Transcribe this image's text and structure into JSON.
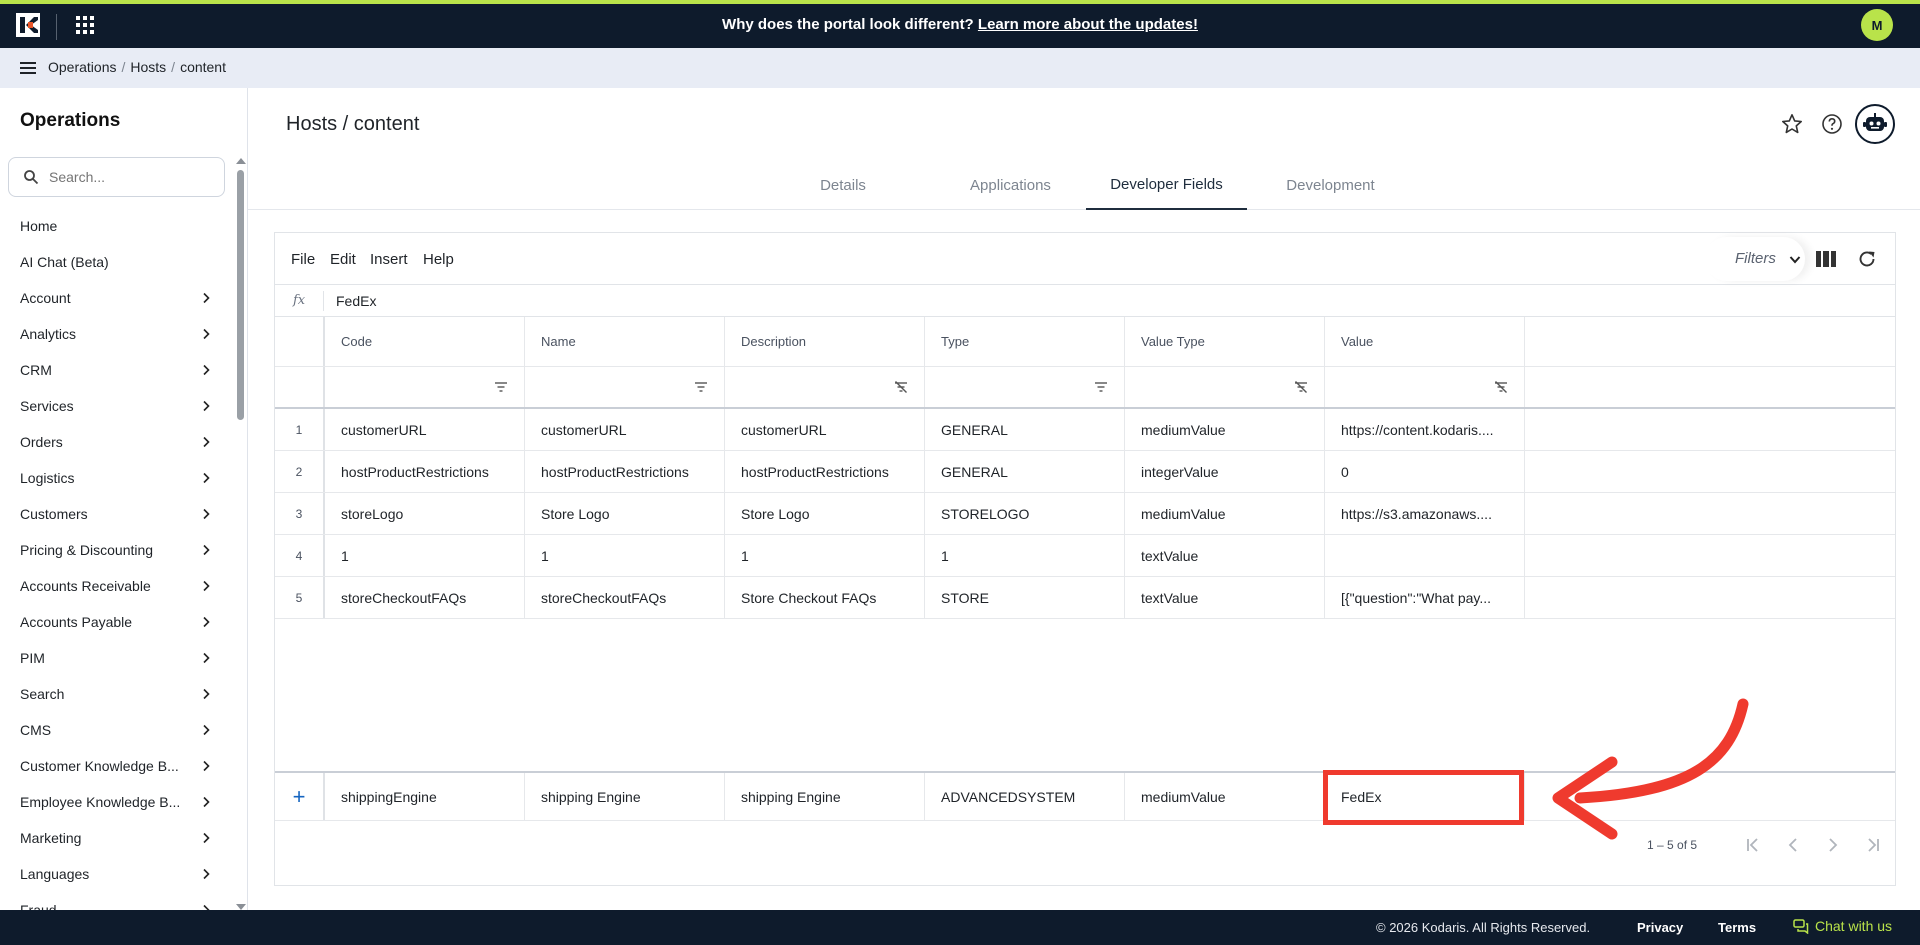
{
  "banner": {
    "question": "Why does the portal look different?",
    "link": "Learn more about the updates!",
    "avatar_initial": "M"
  },
  "breadcrumb": [
    "Operations",
    "Hosts",
    "content"
  ],
  "sidebar": {
    "title": "Operations",
    "search_placeholder": "Search...",
    "items": [
      {
        "label": "Home",
        "chevron": false
      },
      {
        "label": "AI Chat (Beta)",
        "chevron": false
      },
      {
        "label": "Account",
        "chevron": true
      },
      {
        "label": "Analytics",
        "chevron": true
      },
      {
        "label": "CRM",
        "chevron": true
      },
      {
        "label": "Services",
        "chevron": true
      },
      {
        "label": "Orders",
        "chevron": true
      },
      {
        "label": "Logistics",
        "chevron": true
      },
      {
        "label": "Customers",
        "chevron": true
      },
      {
        "label": "Pricing & Discounting",
        "chevron": true
      },
      {
        "label": "Accounts Receivable",
        "chevron": true
      },
      {
        "label": "Accounts Payable",
        "chevron": true
      },
      {
        "label": "PIM",
        "chevron": true
      },
      {
        "label": "Search",
        "chevron": true
      },
      {
        "label": "CMS",
        "chevron": true
      },
      {
        "label": "Customer Knowledge B...",
        "chevron": true
      },
      {
        "label": "Employee Knowledge B...",
        "chevron": true
      },
      {
        "label": "Marketing",
        "chevron": true
      },
      {
        "label": "Languages",
        "chevron": true
      },
      {
        "label": "Fraud",
        "chevron": true
      }
    ]
  },
  "page": {
    "title": "Hosts / content",
    "tabs": [
      "Details",
      "Applications",
      "Developer Fields",
      "Development"
    ],
    "active_tab": "Developer Fields"
  },
  "grid": {
    "menu": [
      "File",
      "Edit",
      "Insert",
      "Help"
    ],
    "filters_label": "Filters",
    "fx_label": "fx",
    "fx_value": "FedEx",
    "columns": [
      "Code",
      "Name",
      "Description",
      "Type",
      "Value Type",
      "Value"
    ],
    "rows": [
      {
        "n": "1",
        "cells": [
          "customerURL",
          "customerURL",
          "customerURL",
          "GENERAL",
          "mediumValue",
          "https://content.kodaris...."
        ]
      },
      {
        "n": "2",
        "cells": [
          "hostProductRestrictions",
          "hostProductRestrictions",
          "hostProductRestrictions",
          "GENERAL",
          "integerValue",
          "0"
        ]
      },
      {
        "n": "3",
        "cells": [
          "storeLogo",
          "Store Logo",
          "Store Logo",
          "STORELOGO",
          "mediumValue",
          "https://s3.amazonaws...."
        ]
      },
      {
        "n": "4",
        "cells": [
          "1",
          "1",
          "1",
          "1",
          "textValue",
          ""
        ]
      },
      {
        "n": "5",
        "cells": [
          "storeCheckoutFAQs",
          "storeCheckoutFAQs",
          "Store Checkout FAQs",
          "STORE",
          "textValue",
          "[{\"question\":\"What pay..."
        ]
      }
    ],
    "new_row": {
      "add": "+",
      "cells": [
        "shippingEngine",
        "shipping Engine",
        "shipping Engine",
        "ADVANCEDSYSTEM",
        "mediumValue",
        "FedEx"
      ]
    },
    "pagination": "1 – 5 of 5"
  },
  "footer": {
    "copyright": "© 2026 Kodaris. All Rights Reserved.",
    "privacy": "Privacy",
    "terms": "Terms",
    "chat": "Chat with us"
  },
  "colors": {
    "navy": "#0e1b2c",
    "lime": "#b9e34a",
    "highlight": "#ef3a2e"
  }
}
